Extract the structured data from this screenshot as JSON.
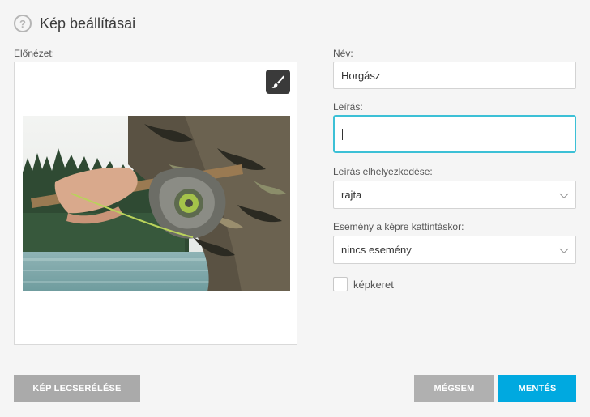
{
  "header": {
    "title": "Kép beállításai",
    "help_glyph": "?"
  },
  "preview": {
    "label": "Előnézet:",
    "edit_icon": "brush-icon"
  },
  "form": {
    "name_label": "Név:",
    "name_value": "Horgász",
    "description_label": "Leírás:",
    "description_value": "",
    "placement_label": "Leírás elhelyezkedése:",
    "placement_value": "rajta",
    "event_label": "Esemény a képre kattintáskor:",
    "event_value": "nincs esemény",
    "frame_label": "képkeret",
    "frame_checked": false
  },
  "buttons": {
    "replace": "KÉP LECSERÉLÉSE",
    "cancel": "MÉGSEM",
    "save": "MENTÉS"
  },
  "colors": {
    "accent": "#00a9e0",
    "focus_border": "#3cc0d6",
    "gray_button": "#aaaaaa",
    "cancel_button": "#b0b0b0"
  }
}
